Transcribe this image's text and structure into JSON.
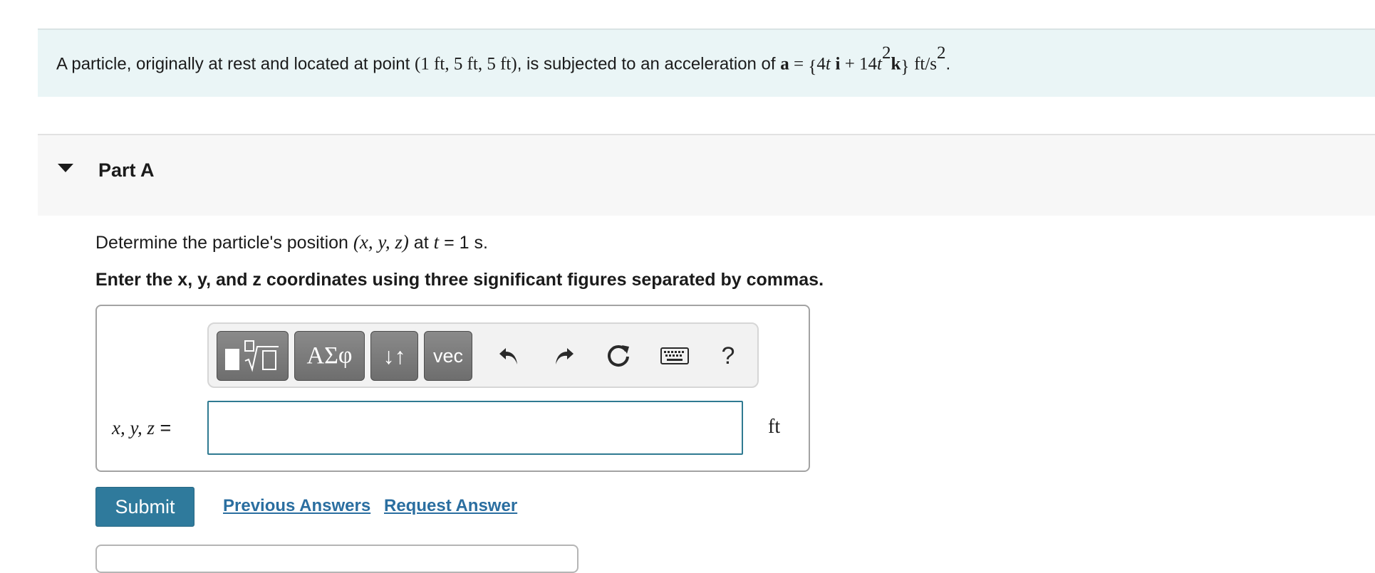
{
  "problem": {
    "text_1": "A particle, originally at rest and located at point ",
    "point": "(1 ft, 5 ft, 5 ft)",
    "text_2": ", is subjected to an acceleration of ",
    "accel_symbol": "a",
    "equals": " = ",
    "brace_open": "{",
    "term_1": "4",
    "term_1_var": "t",
    "unit_i": "i",
    "plus": " + ",
    "term_2": "14",
    "term_2_var": "t",
    "term_2_exp": "2",
    "unit_k": "k",
    "brace_close": "}",
    "accel_unit": "ft/s",
    "accel_unit_exp": "2",
    "period": "."
  },
  "part": {
    "title": "Part A"
  },
  "question": {
    "text_1": "Determine the particle's position ",
    "coords": "(x, y, z)",
    "text_2": " at ",
    "t_var": "t",
    "text_3": " = 1 s."
  },
  "instruction": "Enter the x, y, and z coordinates using three significant figures separated by commas.",
  "toolbar": {
    "greek_label": "ΑΣφ",
    "arrows_label": "↓↑",
    "vec_label": "vec",
    "undo_icon": "↶",
    "redo_icon": "↷",
    "reset_icon": "↻",
    "help_label": "?"
  },
  "answer": {
    "label": "x, y, z",
    "label_eq": " =",
    "value": "",
    "unit": "ft"
  },
  "actions": {
    "submit_label": "Submit",
    "previous_label": "Previous Answers",
    "request_label": "Request Answer"
  },
  "colors": {
    "problem_bg": "#eaf5f6",
    "accent": "#2f7a9c",
    "link": "#2a6ea0"
  }
}
